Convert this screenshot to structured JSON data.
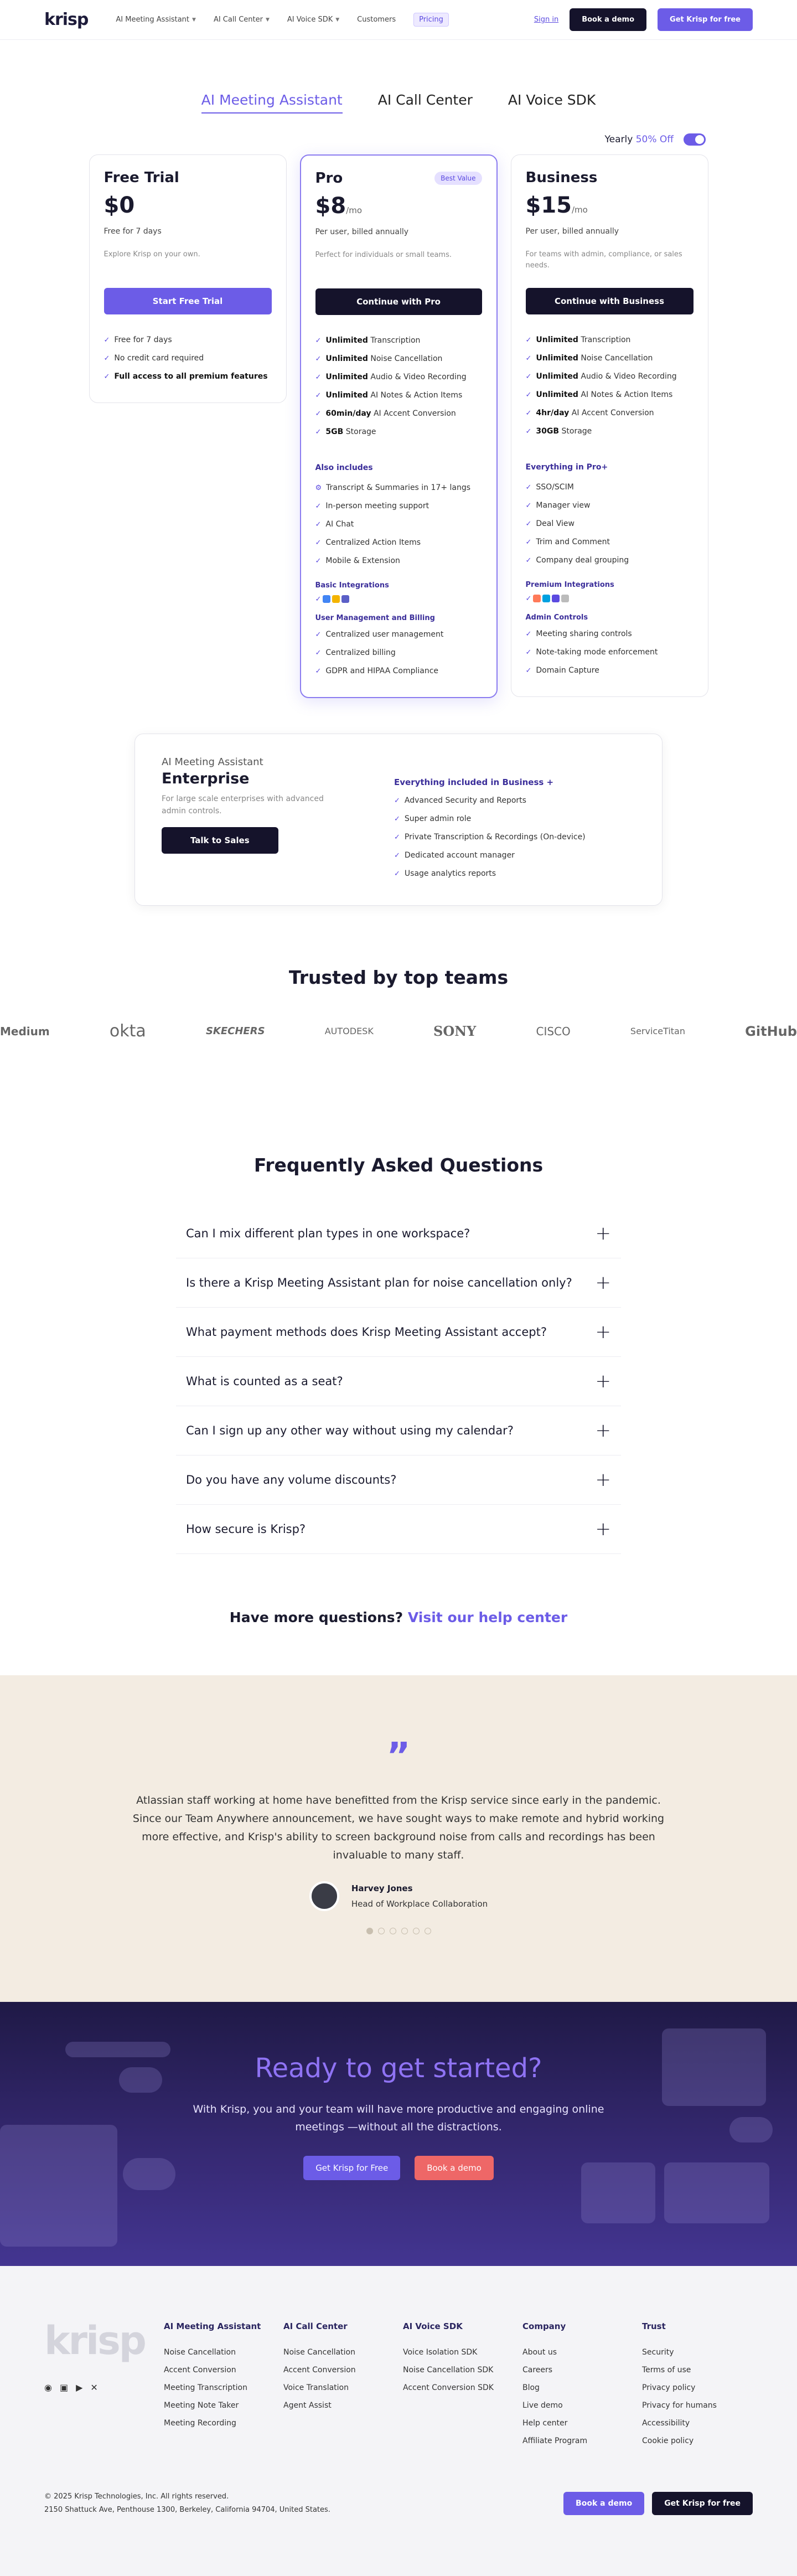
{
  "header": {
    "logo": "krisp",
    "nav": [
      {
        "label": "AI Meeting Assistant",
        "chevron": true
      },
      {
        "label": "AI Call Center",
        "chevron": true
      },
      {
        "label": "AI Voice SDK",
        "chevron": true
      },
      {
        "label": "Customers",
        "chevron": false
      },
      {
        "label": "Pricing",
        "chevron": false
      }
    ],
    "signin": "Sign in",
    "demo": "Book a demo",
    "free": "Get Krisp for free"
  },
  "tabs": [
    "AI Meeting Assistant",
    "AI Call Center",
    "AI Voice SDK"
  ],
  "billing": {
    "yearly": "Yearly",
    "off": "50% Off"
  },
  "plans": [
    {
      "name": "Free Trial",
      "badge": "",
      "price": "$0",
      "per": "",
      "billed": "Free for 7 days",
      "desc": "Explore Krisp on your own.",
      "cta": "Start Free Trial",
      "features": [
        [
          "",
          "Free for 7 days"
        ],
        [
          "",
          "No credit card required"
        ],
        [
          "Full access to all premium features",
          ""
        ]
      ]
    },
    {
      "name": "Pro",
      "badge": "Best Value",
      "price": "$8",
      "per": "/mo",
      "billed": "Per user, billed annually",
      "desc": "Perfect for individuals or small teams.",
      "cta": "Continue with Pro",
      "features": [
        [
          "Unlimited",
          " Transcription"
        ],
        [
          "Unlimited",
          " Noise Cancellation"
        ],
        [
          "Unlimited",
          " Audio & Video Recording"
        ],
        [
          "Unlimited",
          " AI Notes & Action Items"
        ],
        [
          "60min/day",
          " AI Accent Conversion"
        ],
        [
          "5GB",
          " Storage"
        ]
      ],
      "also_title": "Also includes",
      "also": [
        "Transcript & Summaries in 17+ langs",
        "In-person meeting support",
        "AI Chat",
        "Centralized Action Items",
        "Mobile & Extension"
      ],
      "integrations_title": "Basic Integrations",
      "mgmt_title": "User Management and Billing",
      "mgmt": [
        "Centralized user management",
        "Centralized billing",
        "GDPR and HIPAA Compliance"
      ]
    },
    {
      "name": "Business",
      "badge": "",
      "price": "$15",
      "per": "/mo",
      "billed": "Per user, billed annually",
      "desc": "For teams with admin, compliance, or sales needs.",
      "cta": "Continue with Business",
      "features": [
        [
          "Unlimited",
          " Transcription"
        ],
        [
          "Unlimited",
          " Noise Cancellation"
        ],
        [
          "Unlimited",
          " Audio & Video Recording"
        ],
        [
          "Unlimited",
          " AI Notes & Action Items"
        ],
        [
          "4hr/day",
          " AI Accent Conversion"
        ],
        [
          "30GB",
          " Storage"
        ]
      ],
      "also_title": "Everything in Pro+",
      "also": [
        "SSO/SCIM",
        "Manager view",
        "Deal View",
        "Trim and Comment",
        "Company deal grouping"
      ],
      "integrations_title": "Premium Integrations",
      "mgmt_title": "Admin Controls",
      "mgmt": [
        "Meeting sharing controls",
        "Note-taking mode enforcement",
        "Domain Capture"
      ]
    }
  ],
  "enterprise": {
    "kicker": "AI Meeting Assistant",
    "title": "Enterprise",
    "desc": "For large scale enterprises with advanced admin controls.",
    "cta": "Talk to Sales",
    "list_title": "Everything included in Business +",
    "list": [
      "Advanced Security and Reports",
      "Super admin role",
      "Private Transcription & Recordings (On-device)",
      "Dedicated account manager",
      "Usage analytics reports"
    ]
  },
  "trusted": {
    "title": "Trusted by top teams",
    "logos": [
      "Medium",
      "okta",
      "SKECHERS",
      "AUTODESK",
      "SONY",
      "CISCO",
      "ServiceTitan",
      "GitHub"
    ]
  },
  "faq": {
    "title": "Frequently Asked Questions",
    "items": [
      "Can I mix different plan types in one workspace?",
      "Is there a Krisp Meeting Assistant plan for noise cancellation only?",
      "What payment methods does Krisp Meeting Assistant accept?",
      "What is counted as a seat?",
      "Can I sign up any other way without using my calendar?",
      "Do you have any volume discounts?",
      "How secure is Krisp?"
    ],
    "more": "Have more questions?",
    "more_link": "Visit our help center"
  },
  "testimonial": {
    "text": "Atlassian staff working at home have benefitted from the Krisp service since early in the pandemic. Since our Team Anywhere announcement, we have sought ways to make remote and hybrid working more effective, and Krisp's ability to screen background noise from calls and recordings has been invaluable to many staff.",
    "name": "Harvey Jones",
    "role": "Head of Workplace Collaboration"
  },
  "ready": {
    "title": "Ready to get started?",
    "text": "With Krisp, you and your team will have more productive and engaging online meetings —without all the distractions.",
    "free": "Get Krisp for Free",
    "demo": "Book a demo"
  },
  "footer": {
    "logo": "krisp",
    "cols": [
      {
        "title": "AI Meeting Assistant",
        "links": [
          "Noise Cancellation",
          "Accent Conversion",
          "Meeting Transcription",
          "Meeting Note Taker",
          "Meeting Recording"
        ]
      },
      {
        "title": "AI Call Center",
        "links": [
          "Noise Cancellation",
          "Accent Conversion",
          "Voice Translation",
          "Agent Assist"
        ]
      },
      {
        "title": "AI Voice SDK",
        "links": [
          "Voice Isolation SDK",
          "Noise Cancellation SDK",
          "Accent Conversion SDK"
        ]
      },
      {
        "title": "Company",
        "links": [
          "About us",
          "Careers",
          "Blog",
          "Live demo",
          "Help center",
          "Affiliate Program"
        ]
      },
      {
        "title": "Trust",
        "links": [
          "Security",
          "Terms of use",
          "Privacy policy",
          "Privacy for humans",
          "Accessibility",
          "Cookie policy"
        ]
      }
    ],
    "copyright": "© 2025 Krisp Technologies, Inc. All rights reserved.",
    "address": "2150 Shattuck Ave, Penthouse 1300, Berkeley, California 94704, United States.",
    "demo": "Book a demo",
    "free": "Get Krisp for free"
  }
}
